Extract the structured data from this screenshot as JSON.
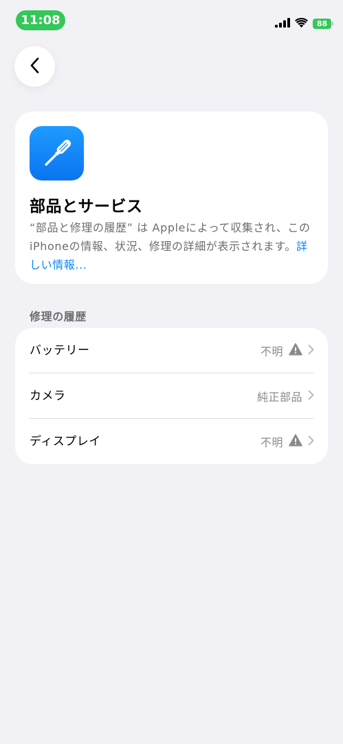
{
  "status_bar": {
    "time": "11:08",
    "battery": "88",
    "icons": [
      "cellular-signal-icon",
      "wifi-icon",
      "battery-icon"
    ]
  },
  "nav": {
    "back_icon": "chevron-left-icon"
  },
  "info_card": {
    "icon": "screwdriver-icon",
    "title": "部品とサービス",
    "description": "“部品と修理の履歴” は Appleによって収集され、このiPhoneの情報、状況、修理の詳細が表示されます。",
    "link": "詳しい情報..."
  },
  "repair_history": {
    "header": "修理の履歴",
    "items": [
      {
        "label": "バッテリー",
        "value": "不明",
        "warning": true
      },
      {
        "label": "カメラ",
        "value": "純正部品",
        "warning": false
      },
      {
        "label": "ディスプレイ",
        "value": "不明",
        "warning": true
      }
    ]
  },
  "colors": {
    "background": "#f1f1f6",
    "accent_green": "#34c759",
    "link_blue": "#0a84ff",
    "secondary_text": "#6d6d72",
    "icon_blue": "#1f8cff"
  }
}
